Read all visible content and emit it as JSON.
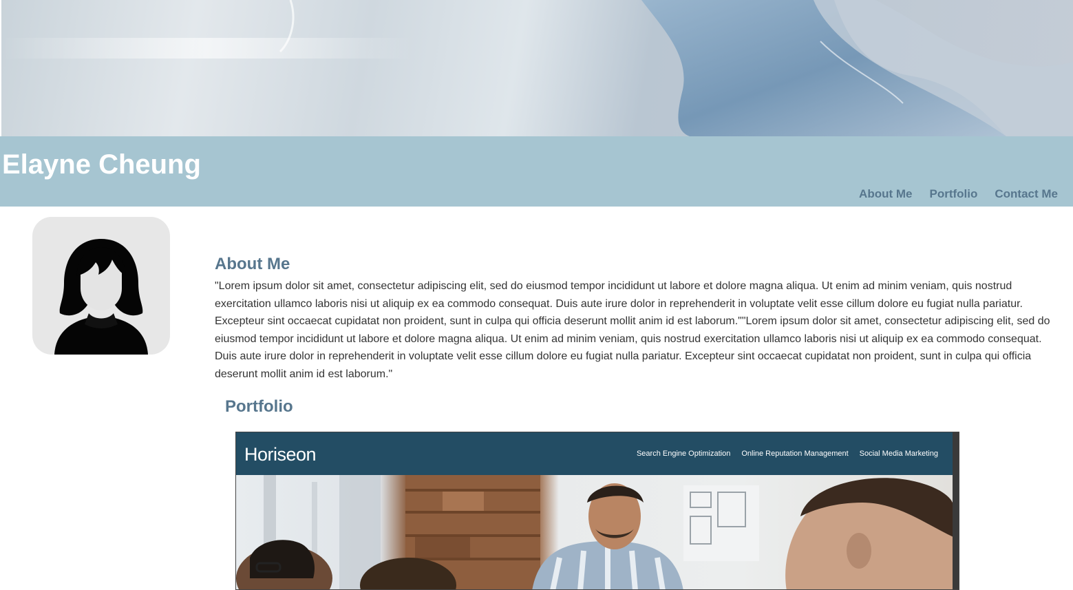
{
  "header": {
    "site_title": "Elayne Cheung"
  },
  "nav": {
    "items": [
      "About Me",
      "Portfolio",
      "Contact Me"
    ]
  },
  "about": {
    "heading": "About Me",
    "text": "\"Lorem ipsum dolor sit amet, consectetur adipiscing elit, sed do eiusmod tempor incididunt ut labore et dolore magna aliqua. Ut enim ad minim veniam, quis nostrud exercitation ullamco laboris nisi ut aliquip ex ea commodo consequat. Duis aute irure dolor in reprehenderit in voluptate velit esse cillum dolore eu fugiat nulla pariatur. Excepteur sint occaecat cupidatat non proident, sunt in culpa qui officia deserunt mollit anim id est laborum.\"\"Lorem ipsum dolor sit amet, consectetur adipiscing elit, sed do eiusmod tempor incididunt ut labore et dolore magna aliqua. Ut enim ad minim veniam, quis nostrud exercitation ullamco laboris nisi ut aliquip ex ea commodo consequat. Duis aute irure dolor in reprehenderit in voluptate velit esse cillum dolore eu fugiat nulla pariatur. Excepteur sint occaecat cupidatat non proident, sunt in culpa qui officia deserunt mollit anim id est laborum.\""
  },
  "portfolio": {
    "heading": "Portfolio",
    "project_screenshot": {
      "logo": "Horiseon",
      "nav": [
        "Search Engine Optimization",
        "Online Reputation Management",
        "Social Media Marketing"
      ]
    }
  },
  "colors": {
    "header_bar": "#a6c5d1",
    "accent_text": "#57768d",
    "project_header": "#234d64"
  }
}
